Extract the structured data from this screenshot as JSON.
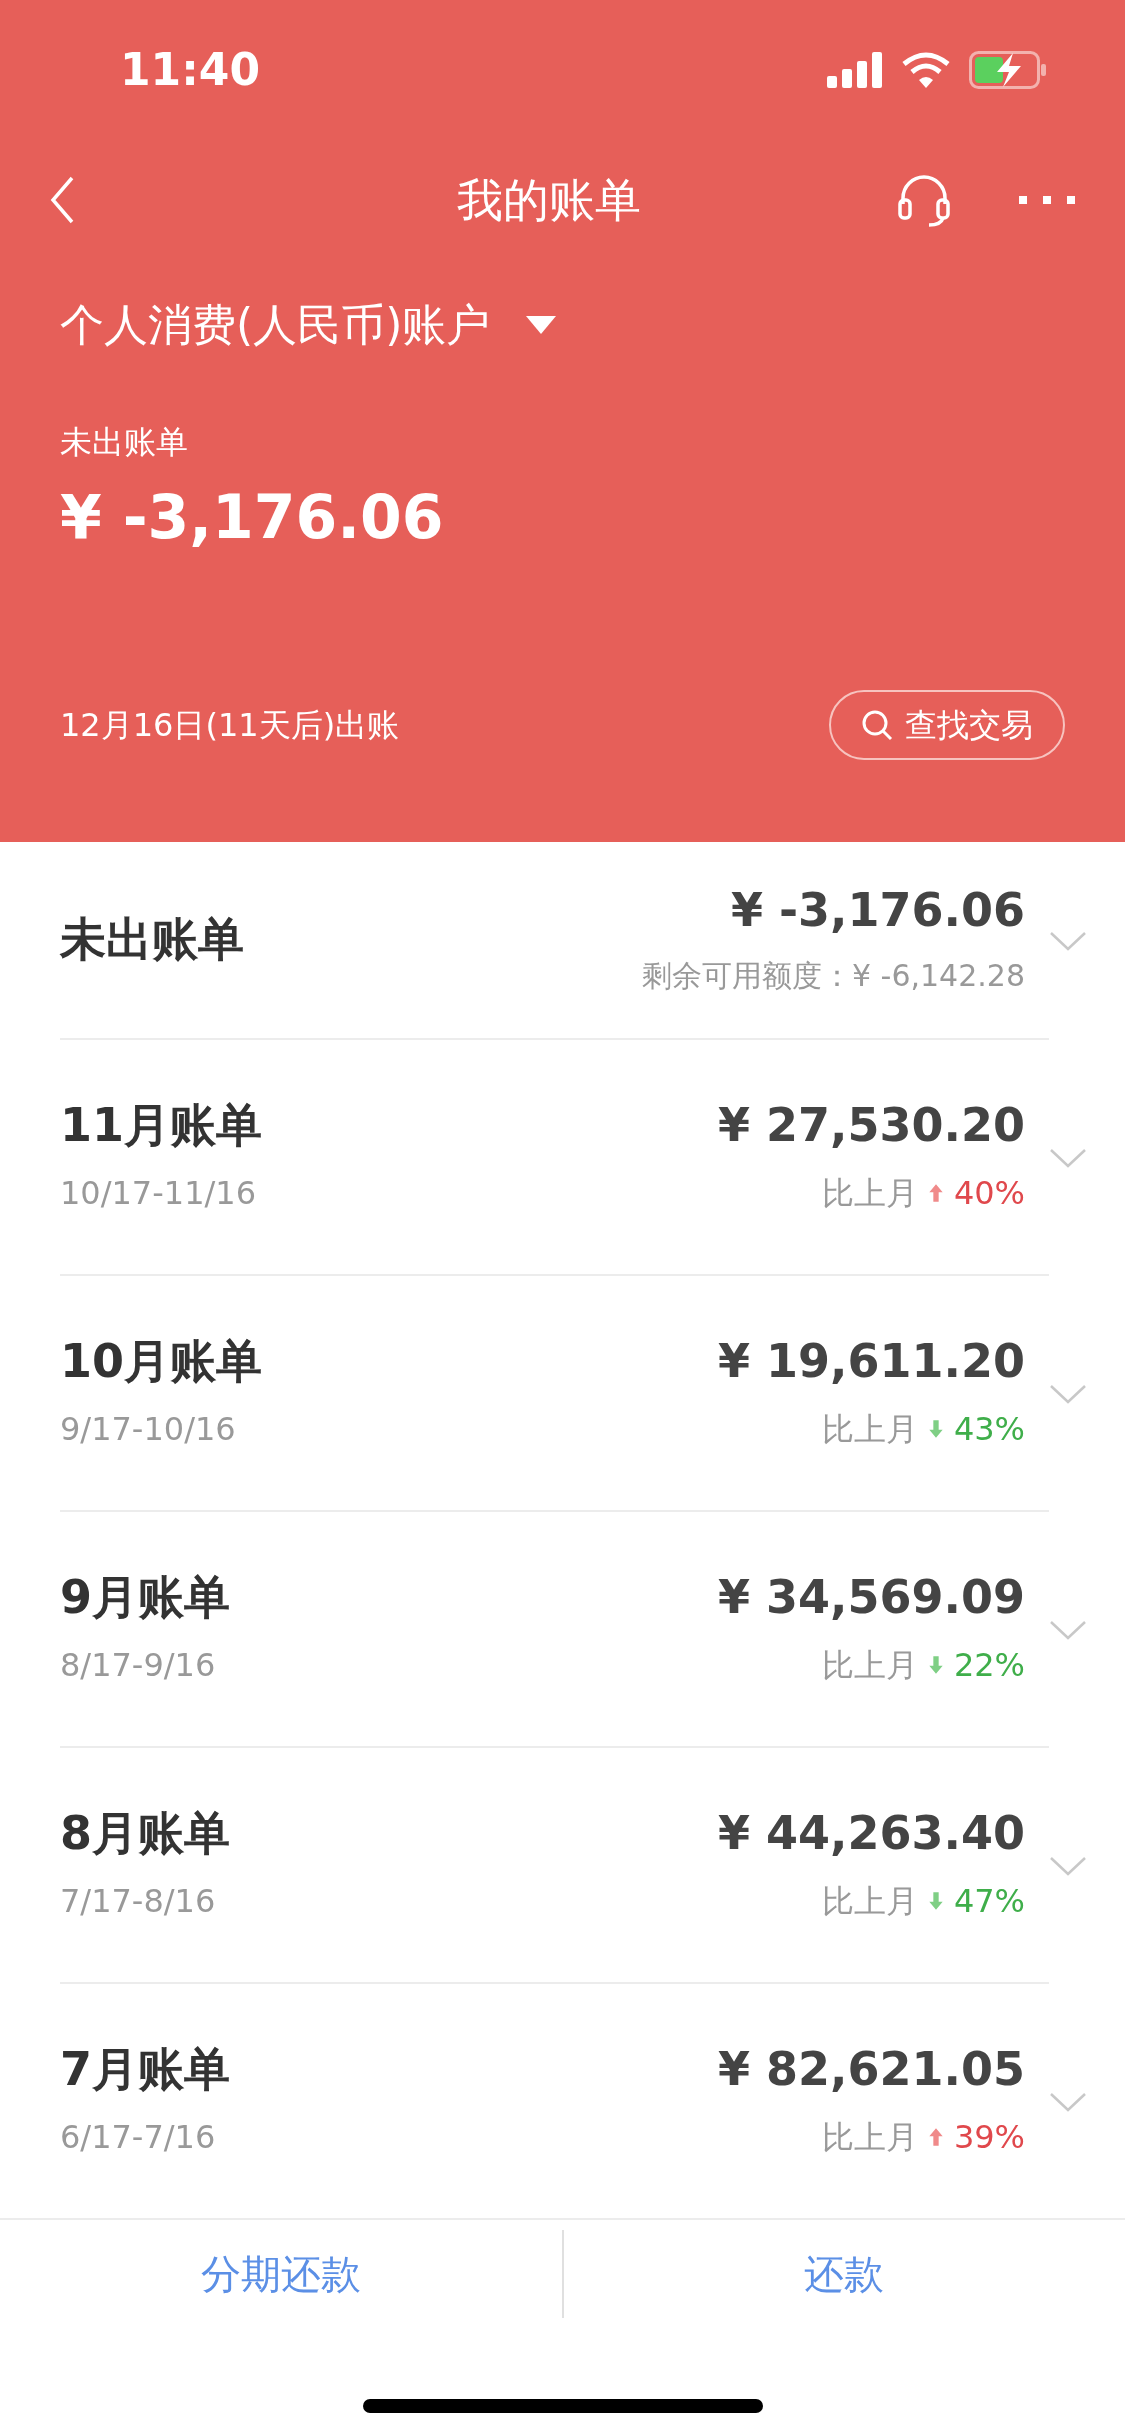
{
  "status_bar": {
    "time": "11:40"
  },
  "nav": {
    "title": "我的账单"
  },
  "account": {
    "name": "个人消费(人民币)账户"
  },
  "summary": {
    "label": "未出账单",
    "amount": "¥ -3,176.06",
    "due": "12月16日(11天后)出账",
    "search_button": "查找交易"
  },
  "bills": [
    {
      "kind": "current",
      "title": "未出账单",
      "amount": "¥ -3,176.06",
      "note": "剩余可用额度：¥ -6,142.28"
    },
    {
      "kind": "month",
      "title": "11月账单",
      "period": "10/17-11/16",
      "amount": "¥ 27,530.20",
      "compare": "比上月",
      "increased": true,
      "change": "40%"
    },
    {
      "kind": "month",
      "title": "10月账单",
      "period": "9/17-10/16",
      "amount": "¥ 19,611.20",
      "compare": "比上月",
      "increased": false,
      "change": "43%"
    },
    {
      "kind": "month",
      "title": "9月账单",
      "period": "8/17-9/16",
      "amount": "¥ 34,569.09",
      "compare": "比上月",
      "increased": false,
      "change": "22%"
    },
    {
      "kind": "month",
      "title": "8月账单",
      "period": "7/17-8/16",
      "amount": "¥ 44,263.40",
      "compare": "比上月",
      "increased": false,
      "change": "47%"
    },
    {
      "kind": "month",
      "title": "7月账单",
      "period": "6/17-7/16",
      "amount": "¥ 82,621.05",
      "compare": "比上月",
      "increased": true,
      "change": "39%"
    }
  ],
  "bottom_actions": [
    "分期还款",
    "还款"
  ]
}
